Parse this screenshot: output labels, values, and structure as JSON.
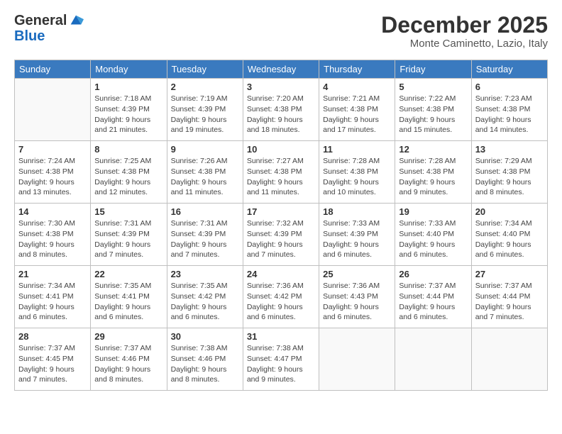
{
  "header": {
    "logo_line1": "General",
    "logo_line2": "Blue",
    "month": "December 2025",
    "location": "Monte Caminetto, Lazio, Italy"
  },
  "columns": [
    "Sunday",
    "Monday",
    "Tuesday",
    "Wednesday",
    "Thursday",
    "Friday",
    "Saturday"
  ],
  "weeks": [
    [
      {
        "day": "",
        "info": ""
      },
      {
        "day": "1",
        "info": "Sunrise: 7:18 AM\nSunset: 4:39 PM\nDaylight: 9 hours\nand 21 minutes."
      },
      {
        "day": "2",
        "info": "Sunrise: 7:19 AM\nSunset: 4:39 PM\nDaylight: 9 hours\nand 19 minutes."
      },
      {
        "day": "3",
        "info": "Sunrise: 7:20 AM\nSunset: 4:38 PM\nDaylight: 9 hours\nand 18 minutes."
      },
      {
        "day": "4",
        "info": "Sunrise: 7:21 AM\nSunset: 4:38 PM\nDaylight: 9 hours\nand 17 minutes."
      },
      {
        "day": "5",
        "info": "Sunrise: 7:22 AM\nSunset: 4:38 PM\nDaylight: 9 hours\nand 15 minutes."
      },
      {
        "day": "6",
        "info": "Sunrise: 7:23 AM\nSunset: 4:38 PM\nDaylight: 9 hours\nand 14 minutes."
      }
    ],
    [
      {
        "day": "7",
        "info": "Sunrise: 7:24 AM\nSunset: 4:38 PM\nDaylight: 9 hours\nand 13 minutes."
      },
      {
        "day": "8",
        "info": "Sunrise: 7:25 AM\nSunset: 4:38 PM\nDaylight: 9 hours\nand 12 minutes."
      },
      {
        "day": "9",
        "info": "Sunrise: 7:26 AM\nSunset: 4:38 PM\nDaylight: 9 hours\nand 11 minutes."
      },
      {
        "day": "10",
        "info": "Sunrise: 7:27 AM\nSunset: 4:38 PM\nDaylight: 9 hours\nand 11 minutes."
      },
      {
        "day": "11",
        "info": "Sunrise: 7:28 AM\nSunset: 4:38 PM\nDaylight: 9 hours\nand 10 minutes."
      },
      {
        "day": "12",
        "info": "Sunrise: 7:28 AM\nSunset: 4:38 PM\nDaylight: 9 hours\nand 9 minutes."
      },
      {
        "day": "13",
        "info": "Sunrise: 7:29 AM\nSunset: 4:38 PM\nDaylight: 9 hours\nand 8 minutes."
      }
    ],
    [
      {
        "day": "14",
        "info": "Sunrise: 7:30 AM\nSunset: 4:38 PM\nDaylight: 9 hours\nand 8 minutes."
      },
      {
        "day": "15",
        "info": "Sunrise: 7:31 AM\nSunset: 4:39 PM\nDaylight: 9 hours\nand 7 minutes."
      },
      {
        "day": "16",
        "info": "Sunrise: 7:31 AM\nSunset: 4:39 PM\nDaylight: 9 hours\nand 7 minutes."
      },
      {
        "day": "17",
        "info": "Sunrise: 7:32 AM\nSunset: 4:39 PM\nDaylight: 9 hours\nand 7 minutes."
      },
      {
        "day": "18",
        "info": "Sunrise: 7:33 AM\nSunset: 4:39 PM\nDaylight: 9 hours\nand 6 minutes."
      },
      {
        "day": "19",
        "info": "Sunrise: 7:33 AM\nSunset: 4:40 PM\nDaylight: 9 hours\nand 6 minutes."
      },
      {
        "day": "20",
        "info": "Sunrise: 7:34 AM\nSunset: 4:40 PM\nDaylight: 9 hours\nand 6 minutes."
      }
    ],
    [
      {
        "day": "21",
        "info": "Sunrise: 7:34 AM\nSunset: 4:41 PM\nDaylight: 9 hours\nand 6 minutes."
      },
      {
        "day": "22",
        "info": "Sunrise: 7:35 AM\nSunset: 4:41 PM\nDaylight: 9 hours\nand 6 minutes."
      },
      {
        "day": "23",
        "info": "Sunrise: 7:35 AM\nSunset: 4:42 PM\nDaylight: 9 hours\nand 6 minutes."
      },
      {
        "day": "24",
        "info": "Sunrise: 7:36 AM\nSunset: 4:42 PM\nDaylight: 9 hours\nand 6 minutes."
      },
      {
        "day": "25",
        "info": "Sunrise: 7:36 AM\nSunset: 4:43 PM\nDaylight: 9 hours\nand 6 minutes."
      },
      {
        "day": "26",
        "info": "Sunrise: 7:37 AM\nSunset: 4:44 PM\nDaylight: 9 hours\nand 6 minutes."
      },
      {
        "day": "27",
        "info": "Sunrise: 7:37 AM\nSunset: 4:44 PM\nDaylight: 9 hours\nand 7 minutes."
      }
    ],
    [
      {
        "day": "28",
        "info": "Sunrise: 7:37 AM\nSunset: 4:45 PM\nDaylight: 9 hours\nand 7 minutes."
      },
      {
        "day": "29",
        "info": "Sunrise: 7:37 AM\nSunset: 4:46 PM\nDaylight: 9 hours\nand 8 minutes."
      },
      {
        "day": "30",
        "info": "Sunrise: 7:38 AM\nSunset: 4:46 PM\nDaylight: 9 hours\nand 8 minutes."
      },
      {
        "day": "31",
        "info": "Sunrise: 7:38 AM\nSunset: 4:47 PM\nDaylight: 9 hours\nand 9 minutes."
      },
      {
        "day": "",
        "info": ""
      },
      {
        "day": "",
        "info": ""
      },
      {
        "day": "",
        "info": ""
      }
    ]
  ]
}
